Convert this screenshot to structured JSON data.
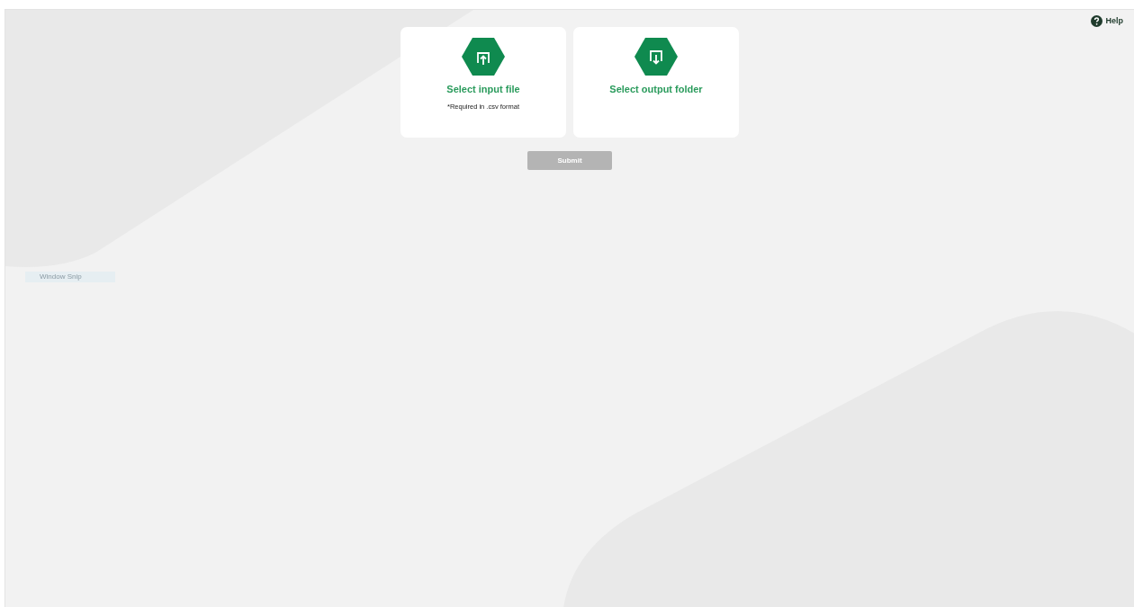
{
  "help": {
    "label": "Help"
  },
  "cards": [
    {
      "kind": "upload",
      "title": "Select input file",
      "note": "*Required in .csv format"
    },
    {
      "kind": "download",
      "title": "Select output folder"
    }
  ],
  "submit": {
    "label": "Submit",
    "disabled": true
  },
  "snip_label": {
    "text": "Window Snip"
  }
}
